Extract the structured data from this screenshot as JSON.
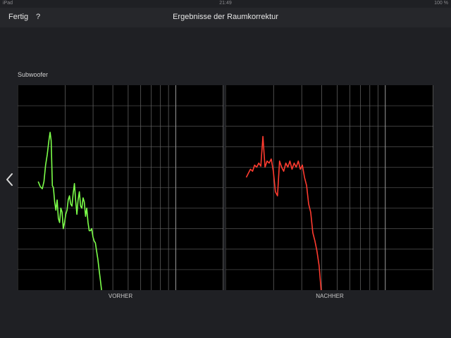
{
  "status_bar": {
    "carrier": "iPad",
    "time": "21:49",
    "battery": "100 %"
  },
  "nav": {
    "done_label": "Fertig",
    "help_label": "?",
    "title": "Ergebnisse der Raumkorrektur"
  },
  "section": {
    "label": "Subwoofer"
  },
  "chart_data": [
    {
      "type": "line",
      "title": "",
      "xlabel": "VORHER",
      "ylabel": "",
      "scale": "log",
      "grid": true,
      "ylim": [
        0,
        10
      ],
      "series": [
        {
          "color": "#7cff4a",
          "x": [
            10,
            11,
            12,
            12.8,
            13.6,
            14.4,
            15.2,
            15.8,
            16.3,
            16.9,
            17.4,
            18,
            18.6,
            19.2,
            19.8,
            20.4,
            21,
            21.6,
            22.2,
            22.8,
            23.4,
            24,
            24.6,
            25.2,
            25.8,
            26.4,
            27,
            27.6,
            28.2,
            28.8,
            29.4,
            30,
            30.6,
            31.2,
            31.8,
            32.4,
            33,
            33.6,
            34.2,
            34.8,
            35.4,
            36,
            36.6,
            37.2,
            37.8,
            38.4,
            39,
            39.6,
            40.2,
            40.8
          ],
          "values": [
            5.3,
            5.05,
            4.95,
            5.3,
            6.1,
            6.6,
            7.3,
            7.7,
            7.3,
            5.1,
            5.0,
            4.3,
            3.9,
            4.4,
            3.5,
            3.3,
            4.0,
            3.8,
            3.0,
            3.3,
            3.7,
            3.9,
            4.4,
            4.6,
            4.2,
            4.1,
            4.7,
            5.2,
            4.4,
            3.7,
            4.4,
            4.8,
            4.1,
            4.0,
            4.5,
            4.3,
            3.6,
            4.0,
            3.3,
            2.9,
            2.9,
            3.0,
            2.6,
            2.4,
            2.3,
            1.9,
            1.5,
            1.0,
            0.5,
            0.0
          ]
        }
      ]
    },
    {
      "type": "line",
      "title": "",
      "xlabel": "NACHHER",
      "ylabel": "",
      "scale": "log",
      "grid": true,
      "ylim": [
        0,
        10
      ],
      "series": [
        {
          "color": "#ff3b2f",
          "x": [
            10,
            11,
            12,
            13,
            14,
            15,
            16,
            17,
            18,
            19,
            20,
            21,
            22,
            23,
            24,
            25,
            26,
            27,
            28,
            29,
            30,
            31,
            32,
            33,
            34,
            35,
            36,
            37,
            38,
            39,
            40,
            41,
            42,
            43,
            44,
            45,
            46
          ],
          "values": [
            5.5,
            5.7,
            5.9,
            5.8,
            6.1,
            6.0,
            6.2,
            6.05,
            7.5,
            6.0,
            6.3,
            6.2,
            6.4,
            5.8,
            4.8,
            4.6,
            6.3,
            6.0,
            5.8,
            6.2,
            6.0,
            6.3,
            5.9,
            6.2,
            6.0,
            6.3,
            5.9,
            6.1,
            5.5,
            5.1,
            4.2,
            3.8,
            2.8,
            2.4,
            1.9,
            1.2,
            0.0
          ]
        }
      ]
    }
  ]
}
